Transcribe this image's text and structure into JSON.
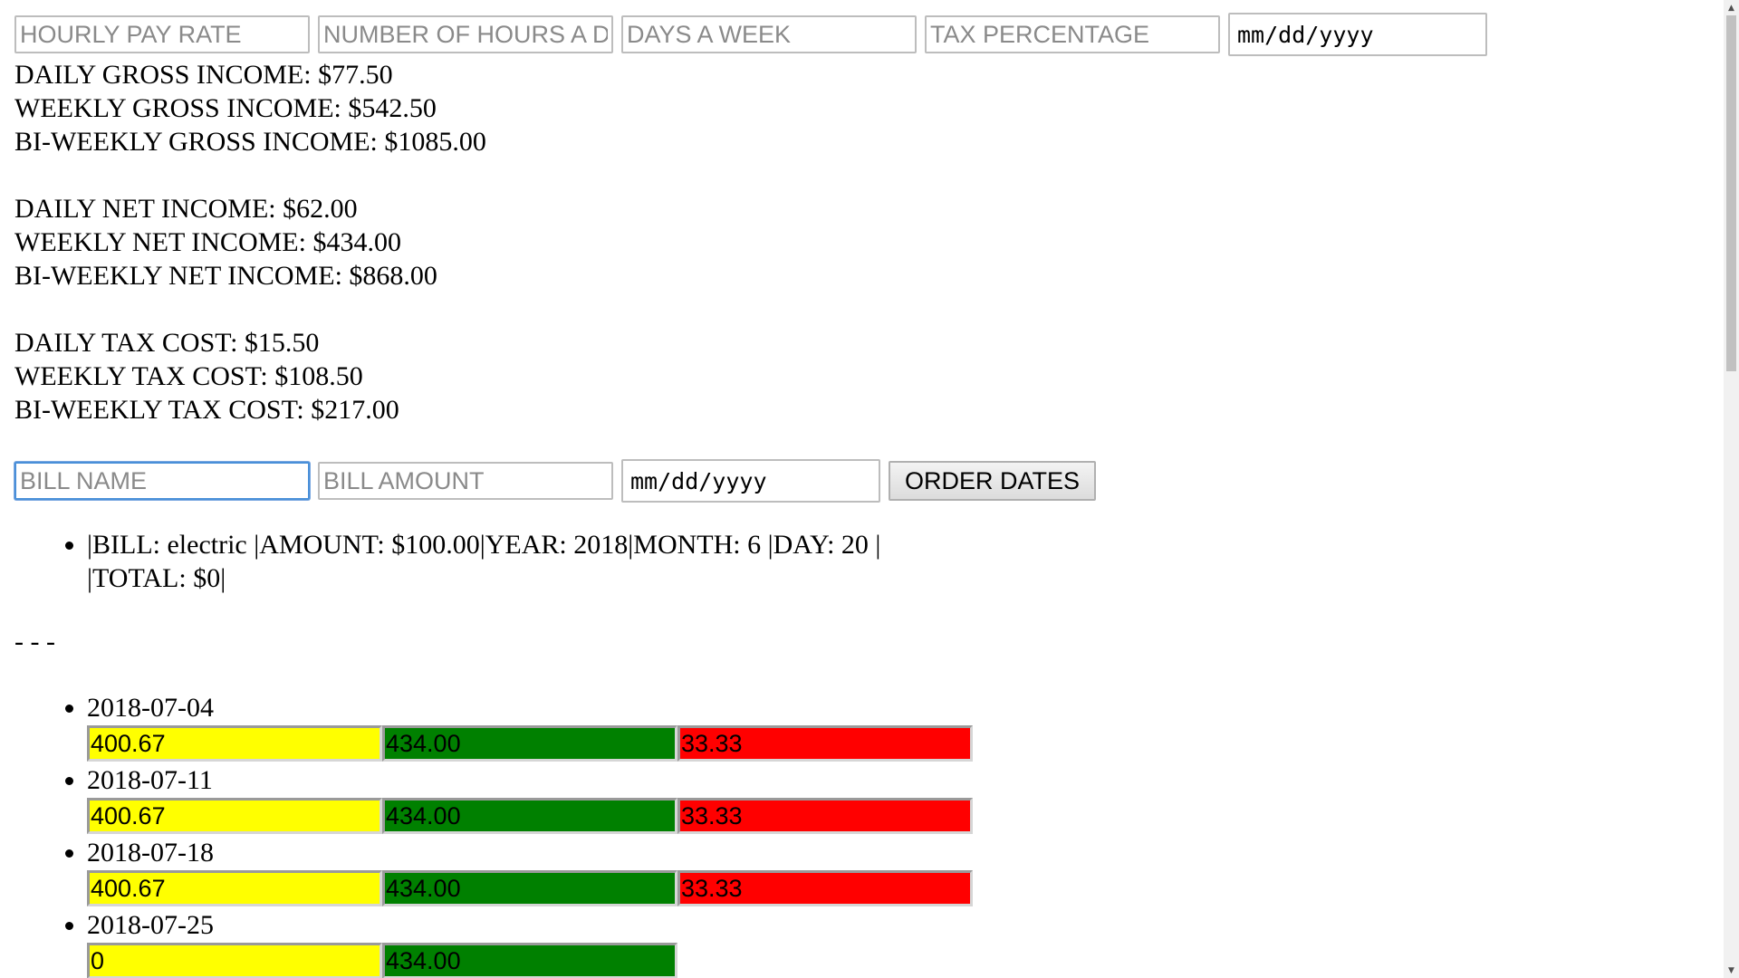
{
  "top_form": {
    "hourly_pay_placeholder": "HOURLY PAY RATE",
    "hours_per_day_placeholder": "NUMBER OF HOURS A DAY",
    "days_per_week_placeholder": "DAYS A WEEK",
    "tax_percentage_placeholder": "TAX PERCENTAGE",
    "date_placeholder": "mm/dd/yyyy"
  },
  "gross": {
    "daily": "DAILY GROSS INCOME: $77.50",
    "weekly": "WEEKLY GROSS INCOME: $542.50",
    "biweekly": "BI-WEEKLY GROSS INCOME: $1085.00"
  },
  "net": {
    "daily": "DAILY NET INCOME: $62.00",
    "weekly": "WEEKLY NET INCOME: $434.00",
    "biweekly": "BI-WEEKLY NET INCOME: $868.00"
  },
  "tax": {
    "daily": "DAILY TAX COST: $15.50",
    "weekly": "WEEKLY TAX COST: $108.50",
    "biweekly": "BI-WEEKLY TAX COST: $217.00"
  },
  "bill_form": {
    "name_placeholder": "BILL NAME",
    "amount_placeholder": "BILL AMOUNT",
    "date_placeholder": "mm/dd/yyyy",
    "order_button": "ORDER DATES"
  },
  "bills": [
    {
      "text": "|BILL: electric |AMOUNT: $100.00|YEAR: 2018|MONTH: 6 |DAY: 20 | |TOTAL: $0|"
    }
  ],
  "separator": "- - -",
  "dates": [
    {
      "date": "2018-07-04",
      "yellow": "400.67",
      "green": "434.00",
      "red": "33.33"
    },
    {
      "date": "2018-07-11",
      "yellow": "400.67",
      "green": "434.00",
      "red": "33.33"
    },
    {
      "date": "2018-07-18",
      "yellow": "400.67",
      "green": "434.00",
      "red": "33.33"
    },
    {
      "date": "2018-07-25",
      "yellow": "0",
      "green": "434.00",
      "red": ""
    }
  ],
  "colors": {
    "yellow": "#ffff00",
    "green": "#008000",
    "red": "#ff0000",
    "focus": "#4a90d9"
  },
  "scrollbar": {
    "up_icon": "chevron-up-icon",
    "down_icon": "chevron-down-icon"
  }
}
